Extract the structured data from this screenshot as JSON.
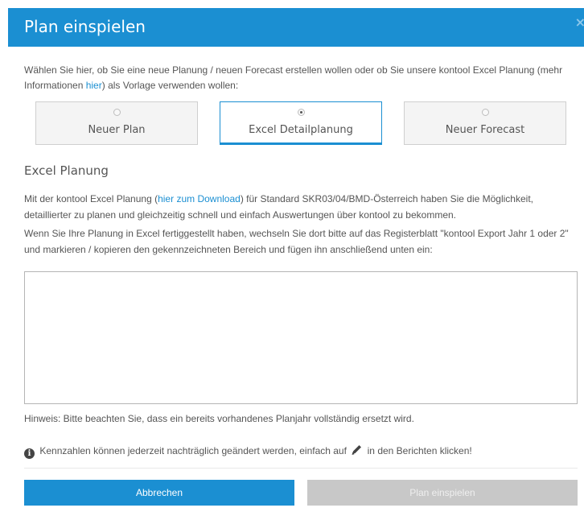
{
  "dialog": {
    "title": "Plan einspielen",
    "close_symbol": "×"
  },
  "intro": {
    "text_before_link": "Wählen Sie hier, ob Sie eine neue Planung / neuen Forecast erstellen wollen oder ob Sie unsere kontool Excel Planung (mehr Informationen ",
    "link": "hier",
    "text_after_link": ") als Vorlage verwenden wollen:"
  },
  "options": [
    {
      "label": "Neuer Plan",
      "selected": false
    },
    {
      "label": "Excel Detailplanung",
      "selected": true
    },
    {
      "label": "Neuer Forecast",
      "selected": false
    }
  ],
  "section": {
    "title": "Excel Planung",
    "para1_before": "Mit der kontool Excel Planung (",
    "para1_link": "hier zum Download",
    "para1_after": ") für Standard SKR03/04/BMD-Österreich haben Sie die Möglichkeit, detaillierter zu planen und gleichzeitig schnell und einfach Auswertungen über kontool zu bekommen.",
    "para2": "Wenn Sie Ihre Planung in Excel fertiggestellt haben, wechseln Sie dort bitte auf das Registerblatt \"kontool Export Jahr 1 oder 2\" und markieren / kopieren den gekennzeichneten Bereich und fügen ihn anschließend unten ein:"
  },
  "paste_area": {
    "value": ""
  },
  "hint": "Hinweis: Bitte beachten Sie, dass ein bereits vorhandenes Planjahr vollständig ersetzt wird.",
  "info": {
    "icon_glyph": "i",
    "before": "Kennzahlen können jederzeit nachträglich geändert werden, einfach auf",
    "after": "in den Berichten klicken!"
  },
  "buttons": {
    "cancel": "Abbrechen",
    "submit": "Plan einspielen"
  },
  "colors": {
    "accent": "#1b8fd2",
    "disabled": "#c8c8c8"
  }
}
